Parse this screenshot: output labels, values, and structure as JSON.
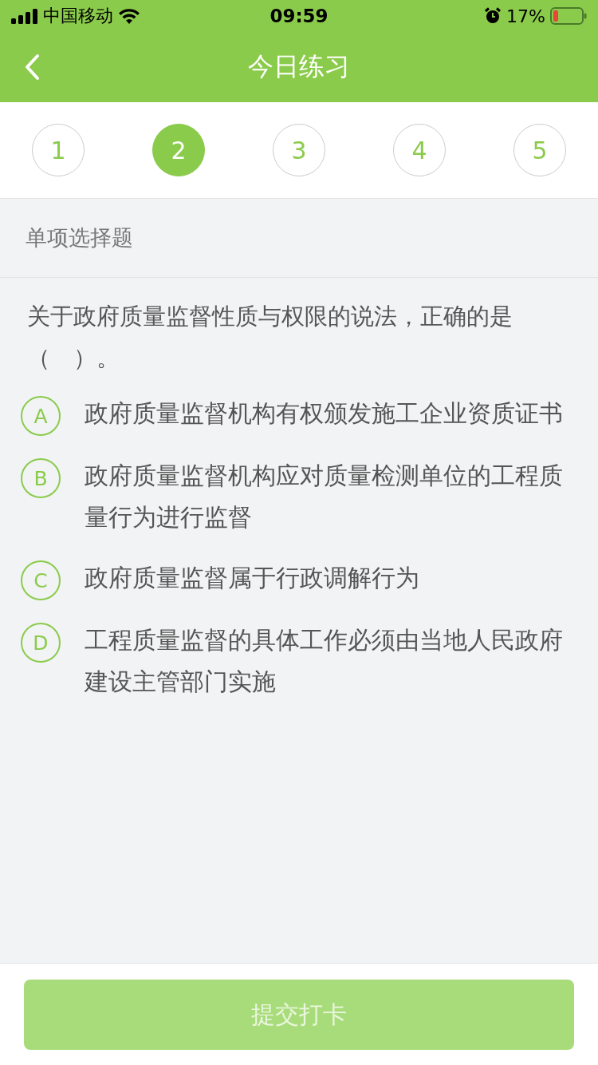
{
  "status_bar": {
    "carrier": "中国移动",
    "time": "09:59",
    "battery_percent": "17%"
  },
  "nav": {
    "title": "今日练习"
  },
  "steps": [
    {
      "label": "1",
      "selected": false
    },
    {
      "label": "2",
      "selected": true
    },
    {
      "label": "3",
      "selected": false
    },
    {
      "label": "4",
      "selected": false
    },
    {
      "label": "5",
      "selected": false
    }
  ],
  "question_type": "单项选择题",
  "question": "关于政府质量监督性质与权限的说法，正确的是（　）。",
  "options": [
    {
      "letter": "A",
      "text": "政府质量监督机构有权颁发施工企业资质证书",
      "selected": false
    },
    {
      "letter": "B",
      "text": "政府质量监督机构应对质量检测单位的工程质量行为进行监督",
      "selected": false
    },
    {
      "letter": "C",
      "text": "政府质量监督属于行政调解行为",
      "selected": false
    },
    {
      "letter": "D",
      "text": "工程质量监督的具体工作必须由当地人民政府建设主管部门实施",
      "selected": false
    }
  ],
  "submit": {
    "label": "提交打卡",
    "disabled": true
  }
}
